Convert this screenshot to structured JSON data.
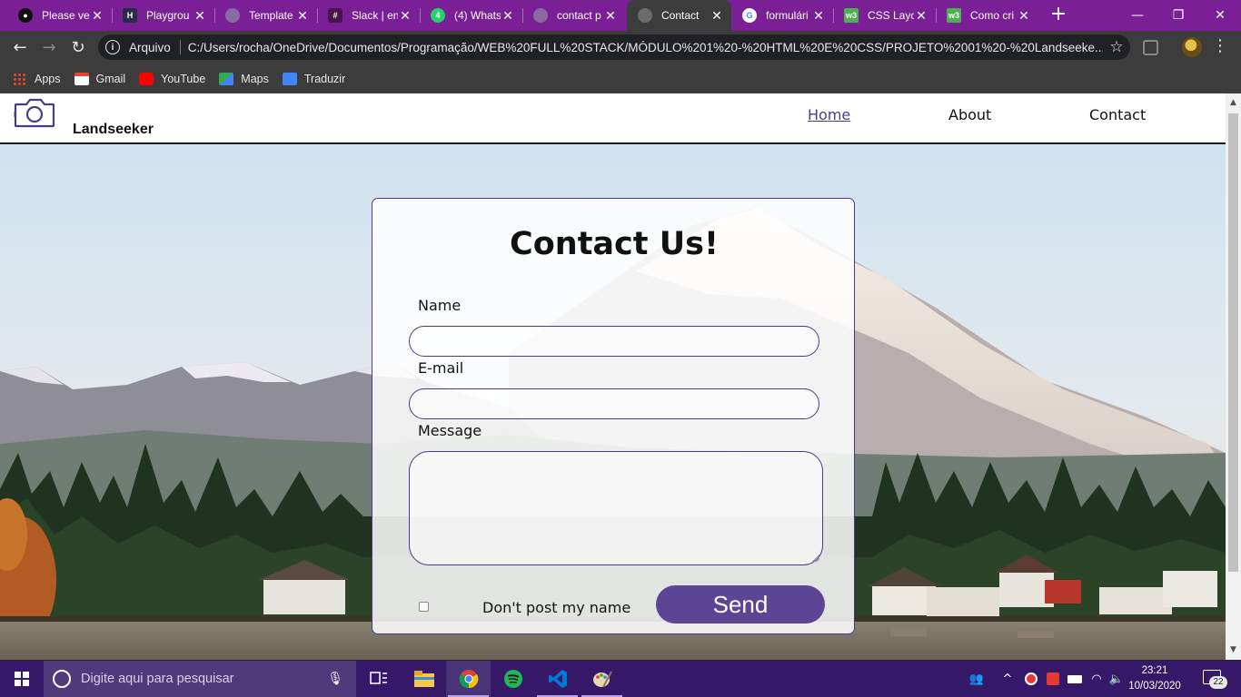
{
  "browser": {
    "tabs": [
      {
        "title": "Please ve",
        "icon": "github-icon"
      },
      {
        "title": "Playgrou",
        "icon": "playground-icon"
      },
      {
        "title": "Template",
        "icon": "globe-icon"
      },
      {
        "title": "Slack | en",
        "icon": "slack-icon"
      },
      {
        "title": "(4) Whats",
        "icon": "whatsapp-icon"
      },
      {
        "title": "contact p",
        "icon": "globe-icon"
      },
      {
        "title": "Contact",
        "icon": "globe-icon",
        "active": true
      },
      {
        "title": "formulári",
        "icon": "google-icon"
      },
      {
        "title": "CSS Layo",
        "icon": "w3schools-icon"
      },
      {
        "title": "Como cri",
        "icon": "w3schools-icon"
      }
    ],
    "omnibox": {
      "scheme": "Arquivo",
      "url": "C:/Users/rocha/OneDrive/Documentos/Programação/WEB%20FULL%20STACK/MÓDULO%201%20-%20HTML%20E%20CSS/PROJETO%2001%20-%20Landseeke..."
    },
    "bookmarks": [
      {
        "label": "Apps",
        "icon": "apps-grid-icon"
      },
      {
        "label": "Gmail",
        "icon": "gmail-icon"
      },
      {
        "label": "YouTube",
        "icon": "youtube-icon"
      },
      {
        "label": "Maps",
        "icon": "maps-icon"
      },
      {
        "label": "Traduzir",
        "icon": "translate-icon"
      }
    ]
  },
  "site": {
    "brand": "Landseeker",
    "nav": [
      {
        "label": "Home",
        "current": true
      },
      {
        "label": "About",
        "current": false
      },
      {
        "label": "Contact",
        "current": false
      }
    ],
    "form": {
      "title": "Contact Us!",
      "name_label": "Name",
      "name_value": "",
      "email_label": "E-mail",
      "email_value": "",
      "message_label": "Message",
      "message_value": "",
      "checkbox_label": "Don't post my name",
      "checkbox_checked": false,
      "send_label": "Send"
    }
  },
  "taskbar": {
    "search_placeholder": "Digite aqui para pesquisar",
    "apps": [
      "task-view-icon",
      "file-explorer-icon",
      "chrome-icon",
      "spotify-icon",
      "vscode-icon",
      "paint-icon"
    ],
    "time": "23:21",
    "date": "10/03/2020",
    "notification_count": "22"
  },
  "colors": {
    "tabstrip": "#7a1f95",
    "accent": "#4b3a88",
    "send_button": "#5b4594",
    "taskbar": "#351968"
  }
}
